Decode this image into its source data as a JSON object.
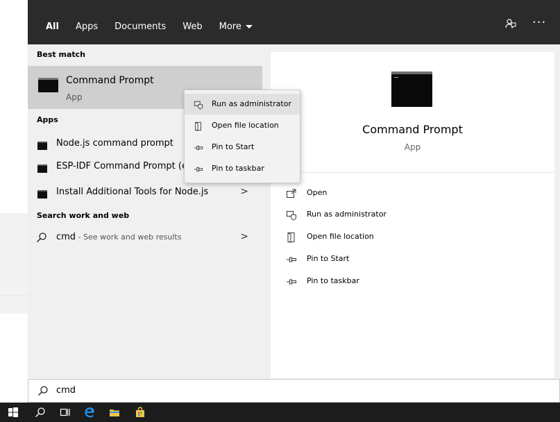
{
  "tabs": [
    {
      "label": "All",
      "active": true
    },
    {
      "label": "Apps",
      "active": false
    },
    {
      "label": "Documents",
      "active": false
    },
    {
      "label": "Web",
      "active": false
    },
    {
      "label": "More",
      "active": false,
      "has_dropdown": true
    }
  ],
  "topbar_icons": [
    "feedback-icon",
    "more-options-icon"
  ],
  "best_match": {
    "section_label": "Best match",
    "title": "Command Prompt",
    "subtitle": "App"
  },
  "apps": {
    "section_label": "Apps",
    "items": [
      {
        "label": "Node.js command prompt"
      },
      {
        "label": "ESP-IDF Command Prompt (e"
      },
      {
        "label": "Install Additional Tools for Node.js",
        "has_chevron": true
      }
    ]
  },
  "web": {
    "section_label": "Search work and web",
    "query": "cmd",
    "suffix": " - See work and web results"
  },
  "context_menu": {
    "items": [
      {
        "label": "Run as administrator",
        "icon": "shield-icon",
        "highlighted": true
      },
      {
        "label": "Open file location",
        "icon": "folder-location-icon"
      },
      {
        "label": "Pin to Start",
        "icon": "pin-icon"
      },
      {
        "label": "Pin to taskbar",
        "icon": "pin-icon"
      }
    ]
  },
  "preview": {
    "title": "Command Prompt",
    "subtitle": "App",
    "actions": [
      {
        "label": "Open",
        "icon": "open-icon"
      },
      {
        "label": "Run as administrator",
        "icon": "shield-icon"
      },
      {
        "label": "Open file location",
        "icon": "folder-location-icon"
      },
      {
        "label": "Pin to Start",
        "icon": "pin-icon"
      },
      {
        "label": "Pin to taskbar",
        "icon": "pin-icon"
      }
    ]
  },
  "search": {
    "value": "cmd"
  },
  "colors": {
    "topbar": "#2b2b2b",
    "panel": "#f0f0f0",
    "selected": "#cfcfcf",
    "taskbar": "#1c1c1c",
    "edge_blue": "#1f8ee8",
    "folder_yellow": "#f6c445",
    "store_yellow": "#f2c94c"
  }
}
